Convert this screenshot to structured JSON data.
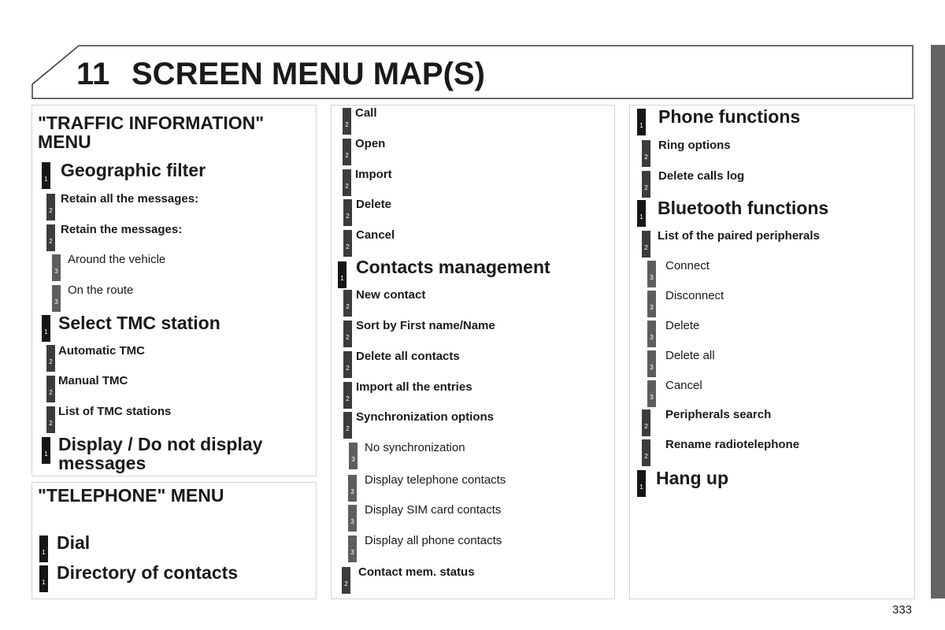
{
  "header": {
    "chapter_number": "11",
    "title": "SCREEN MENU MAP(S)"
  },
  "colors": {
    "level1_badge": "#161616",
    "level2_badge": "#3c3c3c",
    "level3_badge": "#5e5e5e",
    "side_tab": "#646464",
    "header_border": "#2e3a4a"
  },
  "traffic_menu": {
    "title": "\"TRAFFIC INFORMATION\" MENU",
    "items": [
      {
        "level": "1",
        "label": "Geographic filter"
      },
      {
        "level": "2",
        "label": "Retain all the messages:"
      },
      {
        "level": "2",
        "label": "Retain the messages:"
      },
      {
        "level": "3",
        "label": "Around the vehicle"
      },
      {
        "level": "3",
        "label": "On the route"
      },
      {
        "level": "1",
        "label": "Select TMC station"
      },
      {
        "level": "2",
        "label": "Automatic TMC"
      },
      {
        "level": "2",
        "label": "Manual TMC"
      },
      {
        "level": "2",
        "label": "List of TMC stations"
      },
      {
        "level": "1",
        "label": "Display / Do not display messages"
      }
    ]
  },
  "telephone_menu": {
    "title": "\"TELEPHONE\" MENU",
    "items": [
      {
        "level": "1",
        "label": "Dial"
      },
      {
        "level": "1",
        "label": "Directory of contacts"
      }
    ]
  },
  "middle_column": {
    "items": [
      {
        "level": "2",
        "label": "Call"
      },
      {
        "level": "2",
        "label": "Open"
      },
      {
        "level": "2",
        "label": "Import"
      },
      {
        "level": "2",
        "label": "Delete"
      },
      {
        "level": "2",
        "label": "Cancel"
      },
      {
        "level": "1",
        "label": "Contacts management"
      },
      {
        "level": "2",
        "label": "New contact"
      },
      {
        "level": "2",
        "label": "Sort by First name/Name"
      },
      {
        "level": "2",
        "label": "Delete all contacts"
      },
      {
        "level": "2",
        "label": "Import all the entries"
      },
      {
        "level": "2",
        "label": "Synchronization options"
      },
      {
        "level": "3",
        "label": "No synchronization"
      },
      {
        "level": "3",
        "label": "Display telephone contacts"
      },
      {
        "level": "3",
        "label": "Display SIM card contacts"
      },
      {
        "level": "3",
        "label": "Display all phone contacts"
      },
      {
        "level": "2",
        "label": "Contact mem. status"
      }
    ]
  },
  "right_column": {
    "items": [
      {
        "level": "1",
        "label": "Phone functions"
      },
      {
        "level": "2",
        "label": "Ring options"
      },
      {
        "level": "2",
        "label": "Delete calls log"
      },
      {
        "level": "1",
        "label": "Bluetooth functions"
      },
      {
        "level": "2",
        "label": "List of the paired peripherals"
      },
      {
        "level": "3",
        "label": "Connect"
      },
      {
        "level": "3",
        "label": "Disconnect"
      },
      {
        "level": "3",
        "label": "Delete"
      },
      {
        "level": "3",
        "label": "Delete all"
      },
      {
        "level": "3",
        "label": "Cancel"
      },
      {
        "level": "2",
        "label": "Peripherals search"
      },
      {
        "level": "2",
        "label": "Rename radiotelephone"
      },
      {
        "level": "1",
        "label": "Hang up"
      }
    ]
  },
  "footer": {
    "page_number": "333"
  }
}
